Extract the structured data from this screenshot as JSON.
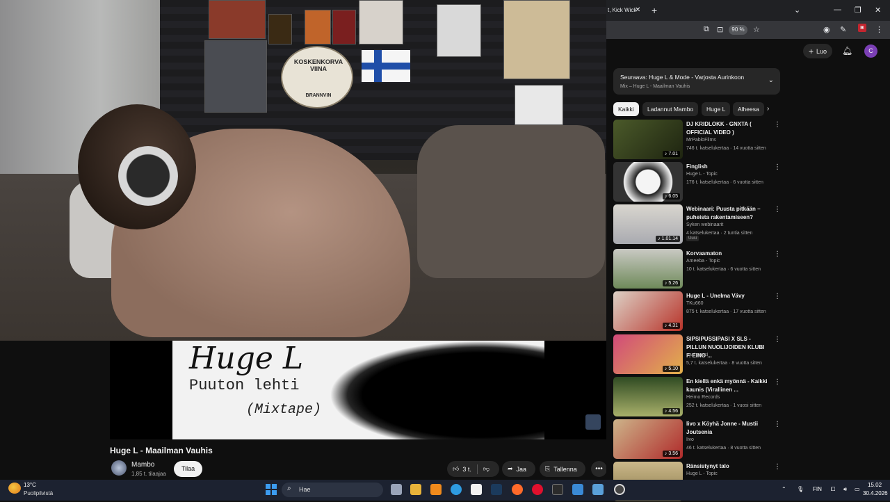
{
  "browser": {
    "tab_title": "t, Kick Wick",
    "zoom": "90 %"
  },
  "youtube": {
    "create_label": "Luo",
    "user_initial": "C",
    "queue": {
      "title": "Seuraava: Huge L & Mode - Varjosta Aurinkoon",
      "subtitle": "Mix – Huge L - Maailman Vauhis"
    },
    "chips": [
      "Kaikki",
      "Ladannut Mambo",
      "Huge L",
      "Alheesa"
    ],
    "recommendations": [
      {
        "title": "DJ KRIDLOKK - GNXTA ( OFFICIAL VIDEO )",
        "channel": "MrPabloFilms",
        "meta": "746 t. katselukertaa · 14 vuotta sitten",
        "duration": "7.01"
      },
      {
        "title": "Finglish",
        "channel": "Huge L - Topic",
        "meta": "176 t. katselukertaa · 6 vuotta sitten",
        "duration": "6.05"
      },
      {
        "title": "Webinaari: Puusta pitkään – puheista rakentamiseen?",
        "channel": "Syken webinaarit",
        "meta": "4 katselukertaa · 2 tuntia sitten",
        "duration": "1.01.14",
        "badge": "Uusi"
      },
      {
        "title": "Korvaamaton",
        "channel": "Ameeba - Topic",
        "meta": "10 t. katselukertaa · 6 vuotta sitten",
        "duration": "5.26"
      },
      {
        "title": "Huge L - Unelma Vävy",
        "channel": "TKu660",
        "meta": "875 t. katselukertaa · 17 vuotta sitten",
        "duration": "4.31"
      },
      {
        "title": "SIPSIPUSSIPASI X SLS - PILLUN NUOLIJOIDEN KLUBI F. EINO ...",
        "channel": "pasi pussi",
        "meta": "5,7 t. katselukertaa · 8 vuotta sitten",
        "duration": "5.10"
      },
      {
        "title": "En kiellä enkä myönnä - Kaikki kaunis (Virallinen ...",
        "channel": "Heimo Records",
        "meta": "252 t. katselukertaa · 1 vuosi sitten",
        "duration": "4.56"
      },
      {
        "title": "Iivo x Köyhä Jonne - Mustii Joutsenia",
        "channel": "Iivo",
        "meta": "46 t. katselukertaa · 8 vuotta sitten",
        "duration": "3.56"
      },
      {
        "title": "Ränsistynyt talo",
        "channel": "Huge L - Topic",
        "meta": "",
        "duration": ""
      }
    ],
    "video": {
      "title": "Huge L - Maailman Vauhis",
      "channel": "Mambo",
      "subscribers": "1,85 t. tilaajaa",
      "subscribe_label": "Tilaa",
      "likes": "3 t.",
      "share_label": "Jaa",
      "save_label": "Tallenna",
      "art_title": "Huge L",
      "art_subtitle": "Puuton lehti",
      "art_mixtape": "(Mixtape)"
    },
    "overlay": {
      "poster_text": "KOSKENKORVA VIINA",
      "poster_sub": "BRANNVIN"
    }
  },
  "taskbar": {
    "temperature": "13°C",
    "weather": "Puolipilvistä",
    "search_placeholder": "Hae",
    "language": "FIN",
    "time": "15.02",
    "date": "30.4.2026"
  }
}
